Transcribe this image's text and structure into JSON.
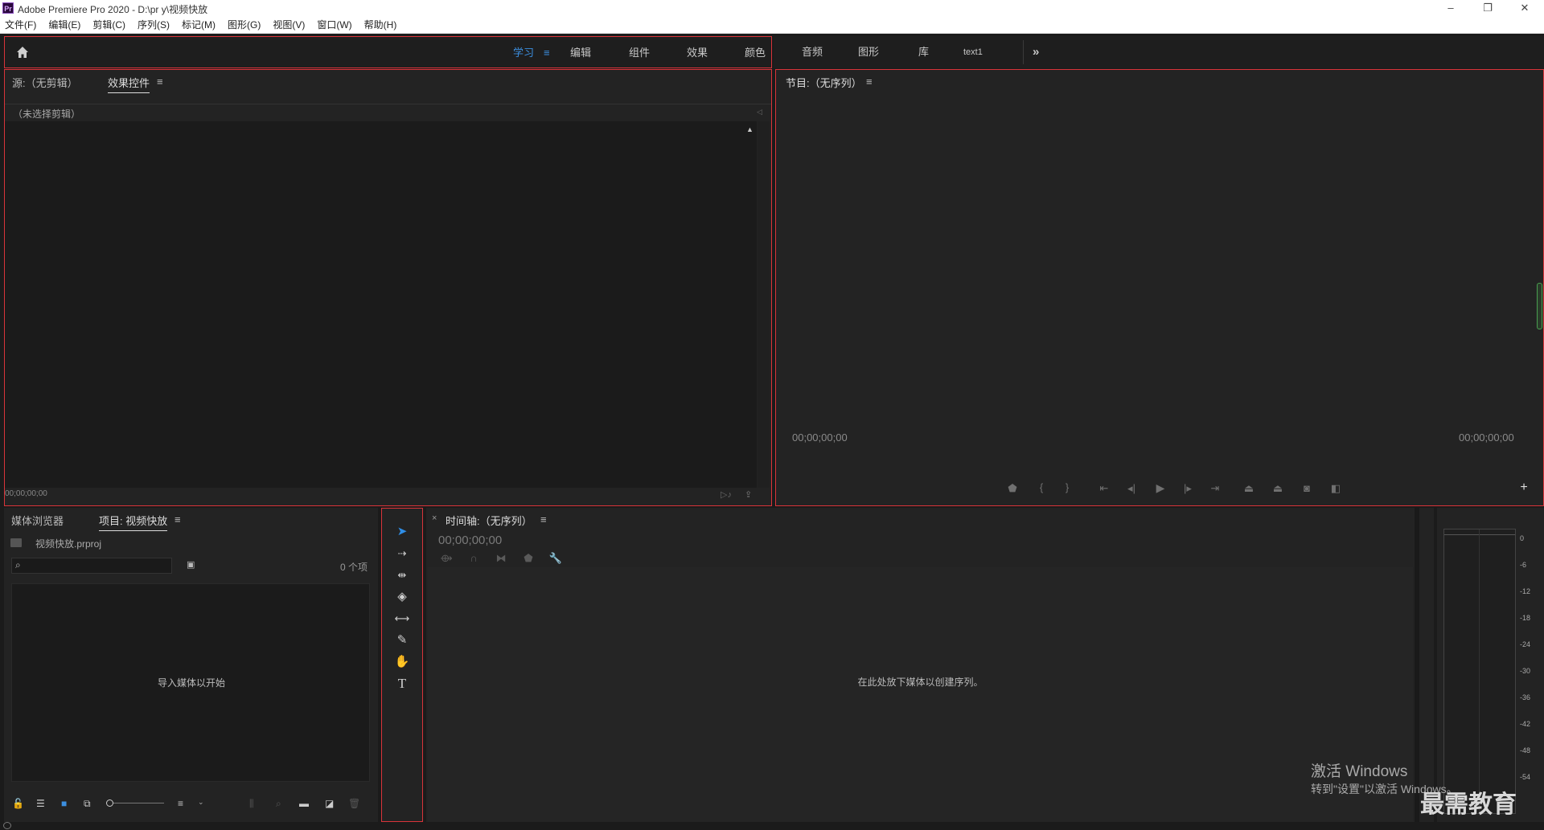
{
  "window": {
    "app_icon": "Pr",
    "title": "Adobe Premiere Pro 2020 - D:\\pr y\\视频快放"
  },
  "menu": [
    "文件(F)",
    "编辑(E)",
    "剪辑(C)",
    "序列(S)",
    "标记(M)",
    "图形(G)",
    "视图(V)",
    "窗口(W)",
    "帮助(H)"
  ],
  "workspaces": {
    "tabs": [
      "学习",
      "编辑",
      "组件",
      "效果",
      "颜色",
      "音频",
      "图形",
      "库",
      "text1"
    ],
    "active": "学习",
    "more": "»"
  },
  "source_panel": {
    "tab_source": "源:（无剪辑）",
    "tab_effects": "效果控件",
    "menu_glyph": "≡",
    "no_clip": "（未选择剪辑）",
    "timecode": "00;00;00;00"
  },
  "program_panel": {
    "title": "节目:（无序列）",
    "menu_glyph": "≡",
    "timecode_left": "00;00;00;00",
    "timecode_right": "00;00;00;00"
  },
  "project_panel": {
    "tab_media": "媒体浏览器",
    "tab_project": "项目: 视频快放",
    "menu_glyph": "≡",
    "file": "视频快放.prproj",
    "count": "0 个项",
    "empty": "导入媒体以开始"
  },
  "timeline_panel": {
    "close": "×",
    "title": "时间轴:（无序列）",
    "menu_glyph": "≡",
    "timecode": "00;00;00;00",
    "empty": "在此处放下媒体以创建序列。"
  },
  "audio_meter": {
    "ticks": [
      "0",
      "-6",
      "-12",
      "-18",
      "-24",
      "-30",
      "-36",
      "-42",
      "-48",
      "-54"
    ]
  },
  "watermark": {
    "line1": "激活 Windows",
    "line2": "转到\"设置\"以激活 Windows。",
    "brand": "最需教育"
  },
  "colors": {
    "accent": "#3c8fe0",
    "highlight_border": "#d9343a"
  }
}
